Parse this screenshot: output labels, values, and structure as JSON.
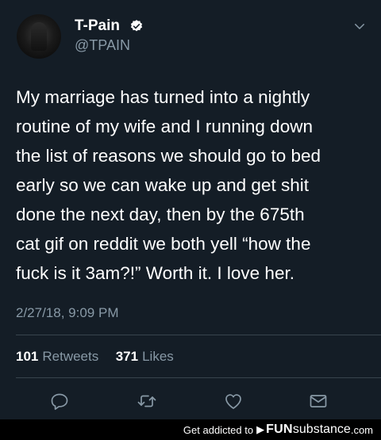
{
  "tweet": {
    "author_name": "T-Pain",
    "author_handle": "@TPAIN",
    "text_lines": [
      "My marriage has turned into a nightly",
      "routine of my wife and I running down",
      "the list of reasons we should go to bed",
      "early so we can wake up and get shit",
      "done the next day, then by the 675th",
      "cat gif on reddit we both yell “how the",
      "fuck is it 3am?!” Worth it. I love her."
    ],
    "timestamp": "2/27/18, 9:09 PM",
    "stats": {
      "retweets_count": "101",
      "retweets_label": "Retweets",
      "likes_count": "371",
      "likes_label": "Likes"
    }
  },
  "icons": [
    "verified-icon",
    "chevron-down-icon",
    "reply-icon",
    "retweet-icon",
    "like-icon",
    "message-icon"
  ],
  "colors": {
    "background": "#141d26",
    "secondary_text": "#8899a6",
    "verified_badge": "#ffffff",
    "divider": "#38444d"
  },
  "footer": {
    "text": "Get addicted to",
    "logo_main": "FUN",
    "logo_sub": "substance",
    "logo_domain": ".com"
  }
}
